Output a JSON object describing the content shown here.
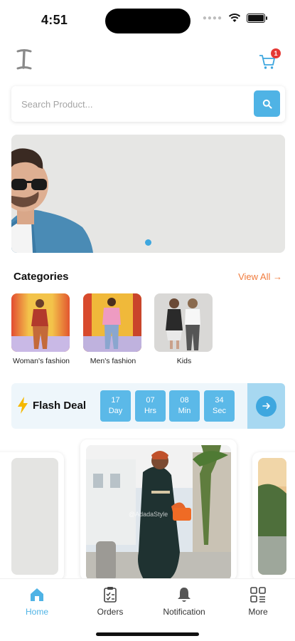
{
  "status": {
    "time": "4:51"
  },
  "header": {
    "cart_count": "1"
  },
  "search": {
    "placeholder": "Search Product..."
  },
  "banner": {
    "slide_count": 1,
    "active_slide": 1
  },
  "categories": {
    "title": "Categories",
    "view_all": "View All",
    "items": [
      {
        "label": "Woman's fashion"
      },
      {
        "label": "Men's fashion"
      },
      {
        "label": "Kids"
      }
    ]
  },
  "flash_deal": {
    "label": "Flash Deal",
    "timer": [
      {
        "value": "17",
        "unit": "Day"
      },
      {
        "value": "07",
        "unit": "Hrs"
      },
      {
        "value": "08",
        "unit": "Min"
      },
      {
        "value": "34",
        "unit": "Sec"
      }
    ]
  },
  "products": {
    "watermark": "@AdadaStyle"
  },
  "tabs": [
    {
      "label": "Home",
      "active": true
    },
    {
      "label": "Orders",
      "active": false
    },
    {
      "label": "Notification",
      "active": false
    },
    {
      "label": "More",
      "active": false
    }
  ],
  "colors": {
    "accent": "#4fb3e5",
    "view_all": "#f07b3c",
    "badge": "#e53935",
    "flash_bg": "#eef6fb"
  }
}
